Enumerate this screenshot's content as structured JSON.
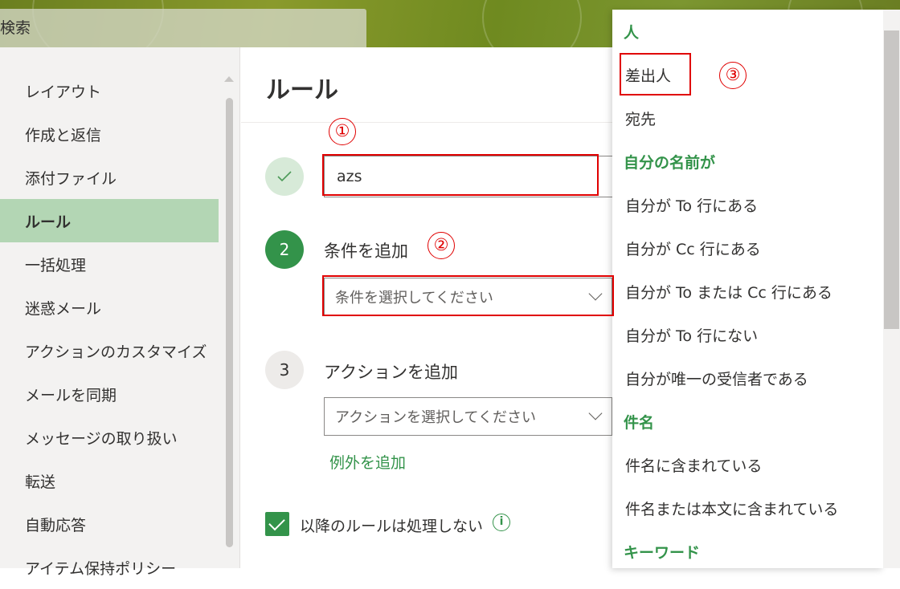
{
  "search": {
    "placeholder": "検索"
  },
  "sidebar": {
    "items": [
      {
        "label": "レイアウト"
      },
      {
        "label": "作成と返信"
      },
      {
        "label": "添付ファイル"
      },
      {
        "label": "ルール",
        "active": true
      },
      {
        "label": "一括処理"
      },
      {
        "label": "迷惑メール"
      },
      {
        "label": "アクションのカスタマイズ"
      },
      {
        "label": "メールを同期"
      },
      {
        "label": "メッセージの取り扱い"
      },
      {
        "label": "転送"
      },
      {
        "label": "自動応答"
      },
      {
        "label": "アイテム保持ポリシー"
      }
    ]
  },
  "main": {
    "title": "ルール",
    "rule_name": {
      "value": "azs"
    },
    "step2": {
      "number": "2",
      "label": "条件を追加",
      "select_placeholder": "条件を選択してください"
    },
    "step3": {
      "number": "3",
      "label": "アクションを追加",
      "select_placeholder": "アクションを選択してください"
    },
    "add_exception": "例外を追加",
    "stop_processing": {
      "label": "以降のルールは処理しない",
      "checked": true
    },
    "info_icon": "i"
  },
  "dropdown": {
    "rows": [
      {
        "label": "人",
        "header": true
      },
      {
        "label": "差出人"
      },
      {
        "label": "宛先"
      },
      {
        "label": "自分の名前が",
        "header": true
      },
      {
        "label": "自分が To 行にある"
      },
      {
        "label": "自分が Cc 行にある"
      },
      {
        "label": "自分が To または Cc 行にある"
      },
      {
        "label": "自分が To 行にない"
      },
      {
        "label": "自分が唯一の受信者である"
      },
      {
        "label": "件名",
        "header": true
      },
      {
        "label": "件名に含まれている"
      },
      {
        "label": "件名または本文に含まれている"
      },
      {
        "label": "キーワード",
        "header": true
      }
    ]
  },
  "annotations": {
    "marker1": "①",
    "marker2": "②",
    "marker3": "③"
  },
  "colors": {
    "accent": "#33934a",
    "active_bg": "#b3d6b4",
    "annotation": "#e00000"
  }
}
